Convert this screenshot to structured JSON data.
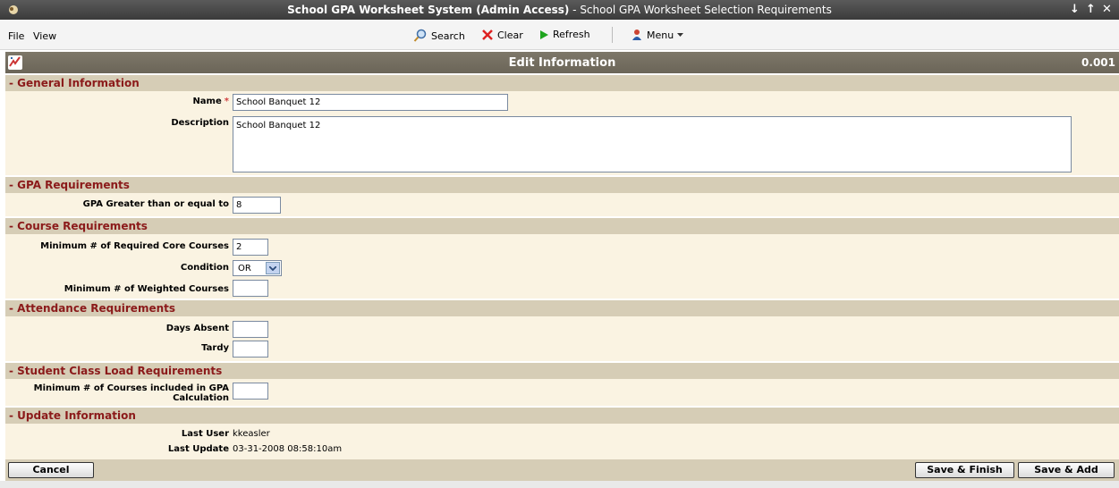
{
  "window": {
    "title_bold": "School GPA Worksheet System (Admin Access)",
    "title_rest": " - School GPA Worksheet Selection Requirements"
  },
  "menubar": {
    "file": "File",
    "view": "View"
  },
  "toolbar": {
    "search": "Search",
    "clear": "Clear",
    "refresh": "Refresh",
    "menu": "Menu"
  },
  "header": {
    "title": "Edit Information",
    "version": "0.001"
  },
  "sections": {
    "general": "- General Information",
    "gpa": "- GPA Requirements",
    "course": "- Course Requirements",
    "attendance": "- Attendance Requirements",
    "class_load": "- Student Class Load Requirements",
    "update": "- Update Information"
  },
  "fields": {
    "name_label": "Name",
    "name_value": "School Banquet 12",
    "description_label": "Description",
    "description_value": "School Banquet 12",
    "gpa_label": "GPA Greater than or equal to",
    "gpa_value": "8",
    "min_core_label": "Minimum # of Required Core Courses",
    "min_core_value": "2",
    "condition_label": "Condition",
    "condition_value": "OR",
    "min_weighted_label": "Minimum # of Weighted Courses",
    "min_weighted_value": "",
    "days_absent_label": "Days Absent",
    "days_absent_value": "",
    "tardy_label": "Tardy",
    "tardy_value": "",
    "min_gpa_courses_label_1": "Minimum # of Courses included in GPA",
    "min_gpa_courses_label_2": "Calculation",
    "min_gpa_courses_value": "",
    "last_user_label": "Last User",
    "last_user_value": "kkeasler",
    "last_update_label": "Last Update",
    "last_update_value": "03-31-2008 08:58:10am"
  },
  "buttons": {
    "cancel": "Cancel",
    "save_finish": "Save & Finish",
    "save_add": "Save & Add"
  },
  "colors": {
    "section_text": "#8b1a1a",
    "section_bg": "#d6cdb6",
    "form_bg": "#faf3e2",
    "header_bg": "#6b6558"
  }
}
